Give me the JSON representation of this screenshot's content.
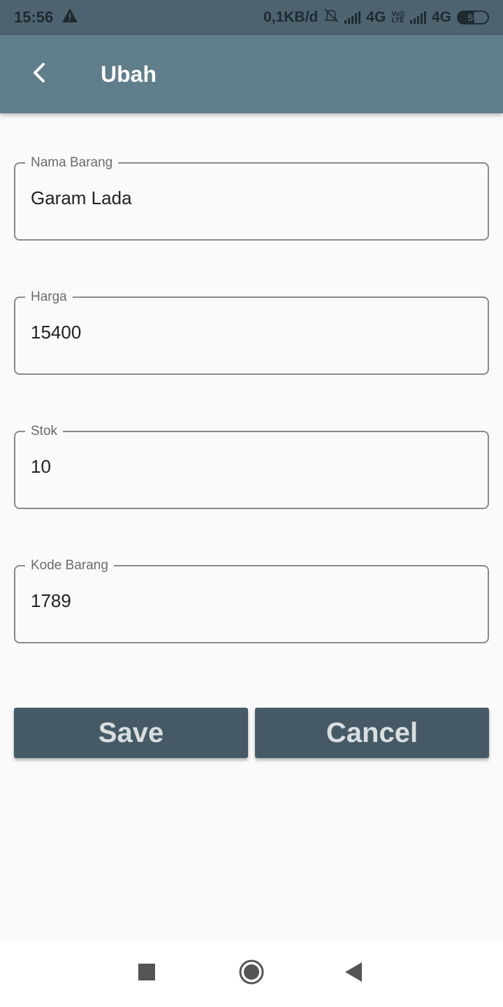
{
  "status_bar": {
    "time": "15:56",
    "network_speed": "0,1KB/d",
    "network_1": "4G",
    "volte_top": "Vo))",
    "volte_bottom": "LTE",
    "network_2": "4G",
    "battery": "55",
    "icons": [
      "warning-icon",
      "notifications-off-icon",
      "signal-icon",
      "signal-icon",
      "battery-icon"
    ]
  },
  "app_bar": {
    "title": "Ubah",
    "back_icon": "chevron-left-icon",
    "color": "#607d8b"
  },
  "form": {
    "fields": [
      {
        "label": "Nama Barang",
        "value": "Garam Lada"
      },
      {
        "label": "Harga",
        "value": "15400"
      },
      {
        "label": "Stok",
        "value": "10"
      },
      {
        "label": "Kode Barang",
        "value": "1789"
      }
    ]
  },
  "buttons": {
    "save_label": "Save",
    "cancel_label": "Cancel",
    "color": "#455a64"
  },
  "nav_bar": {
    "icons": [
      "recents-square-icon",
      "home-circle-icon",
      "back-triangle-icon"
    ]
  }
}
